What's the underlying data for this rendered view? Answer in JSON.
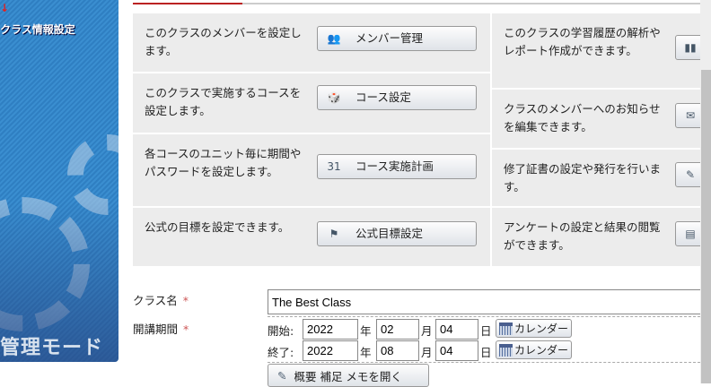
{
  "sidebar": {
    "arrow": "↓",
    "section_title": "クラス情報設定",
    "mode_label": "管理モード"
  },
  "left_items": [
    {
      "desc": "このクラスのメンバーを設定します。",
      "button": "メンバー管理",
      "icon": "members-icon"
    },
    {
      "desc": "このクラスで実施するコースを設定します。",
      "button": "コース設定",
      "icon": "course-icon"
    },
    {
      "desc": "各コースのユニット毎に期間やパスワードを設定します。",
      "button": "コース実施計画",
      "icon": "calendar-icon"
    },
    {
      "desc": "公式の目標を設定できます。",
      "button": "公式目標設定",
      "icon": "flag-icon"
    }
  ],
  "right_items": [
    {
      "desc": "このクラスの学習履歴の解析やレポート作成ができます。",
      "icon": "bar-chart-icon"
    },
    {
      "desc": "クラスのメンバーへのお知らせを編集できます。",
      "icon": "notice-icon"
    },
    {
      "desc": "修了証書の設定や発行を行います。",
      "icon": "certificate-icon"
    },
    {
      "desc": "アンケートの設定と結果の閲覧ができます。",
      "icon": "survey-icon"
    }
  ],
  "form": {
    "class_name_label": "クラス名",
    "required": "*",
    "class_name_value": "The Best Class",
    "period_label": "開講期間",
    "start_label": "開始:",
    "end_label": "終了:",
    "start": {
      "year": "2022",
      "month": "02",
      "day": "04"
    },
    "end": {
      "year": "2022",
      "month": "08",
      "day": "04"
    },
    "year_unit": "年",
    "month_unit": "月",
    "day_unit": "日",
    "calendar_button": "カレンダー",
    "memo_button": "概要 補足 メモを開く"
  }
}
